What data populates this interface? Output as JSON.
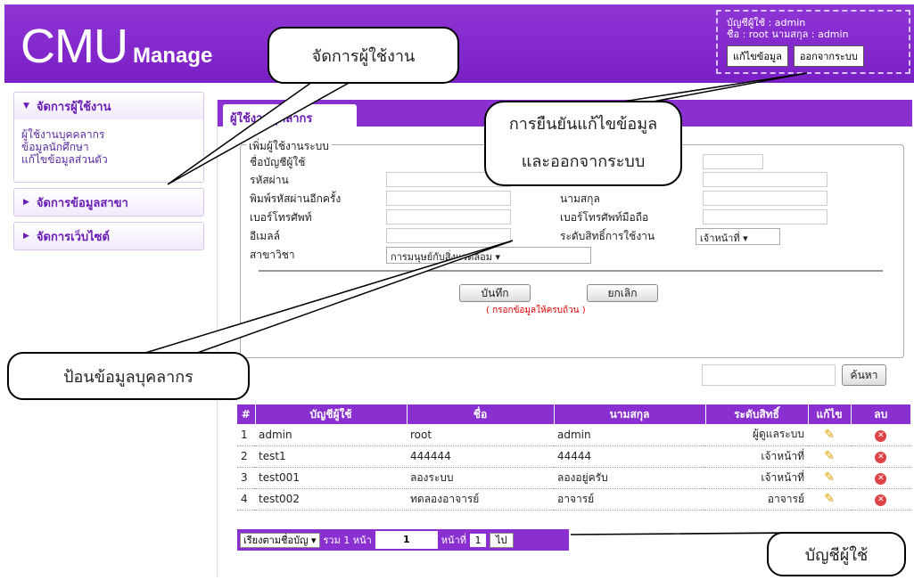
{
  "header": {
    "logo_big": "CMU",
    "logo_small": "Manage",
    "account_line": "บัญชีผู้ใช้ : admin",
    "name_line": "ชื่อ : root นามสกุล : admin",
    "edit_button": "แก้ไขข้อมูล",
    "logout_button": "ออกจากระบบ"
  },
  "sidebar": {
    "menus": [
      {
        "label": "จัดการผู้ใช้งาน",
        "items": [
          "ผู้ใช้งานบุคคลากร",
          "ข้อมูลนักศึกษา",
          "แก้ไขข้อมูลส่วนตัว"
        ]
      },
      {
        "label": "จัดการข้อมูลสาขา"
      },
      {
        "label": "จัดการเว็บไซต์"
      }
    ]
  },
  "main": {
    "tab_label": "ผู้ใช้งานบุคลากร",
    "form": {
      "legend": "เพิ่มผู้ใช้งานระบบ",
      "username_label": "ชื่อบัญชีผู้ใช้",
      "password_label": "รหัสผ่าน",
      "password_confirm_label": "พิมพ์รหัสผ่านอีกครั้ง",
      "phone_label": "เบอร์โทรศัพท์",
      "email_label": "อีเมลล์",
      "branch_label": "สาขาวิชา",
      "branch_value": "การมนุษย์กับสิ่งแวดล้อม",
      "lastname_label": "นามสกุล",
      "mobile_label": "เบอร์โทรศัพท์มือถือ",
      "level_label": "ระดับสิทธิ์การใช้งาน",
      "level_value": "เจ้าหน้าที่",
      "save_button": "บันทึก",
      "cancel_button": "ยกเลิก",
      "note": "( กรอกข้อมูลให้ครบถ้วน )"
    },
    "search_button": "ค้นหา",
    "table": {
      "headers": [
        "#",
        "บัญชีผู้ใช้",
        "ชื่อ",
        "นามสกุล",
        "ระดับสิทธิ์",
        "แก้ไข",
        "ลบ"
      ],
      "rows": [
        {
          "no": "1",
          "user": "admin",
          "name": "root",
          "last": "admin",
          "level": "ผู้ดูแลระบบ"
        },
        {
          "no": "2",
          "user": "test1",
          "name": "444444",
          "last": "44444",
          "level": "เจ้าหน้าที่"
        },
        {
          "no": "3",
          "user": "test001",
          "name": "ลองระบบ",
          "last": "ลองอยู่ครับ",
          "level": "เจ้าหน้าที่"
        },
        {
          "no": "4",
          "user": "test002",
          "name": "ทดลองอาจารย์",
          "last": "อาจารย์",
          "level": "อาจารย์"
        }
      ]
    },
    "pager": {
      "sort_label": "เรียงตามชื่อบัญ",
      "total_label": "รวม 1 หน้า",
      "current_page": "1",
      "page_label": "หน้าที่",
      "page_input": "1",
      "go_button": "ไป"
    }
  },
  "callouts": {
    "manage_users": "จัดการผู้ใช้งาน",
    "confirm_edit": "การยืนยันแก้ไขข้อมูล\nและออกจากระบบ",
    "enter_staff": "ป้อนข้อมูลบุคลากร",
    "user_account": "บัญชีผู้ใช้"
  }
}
